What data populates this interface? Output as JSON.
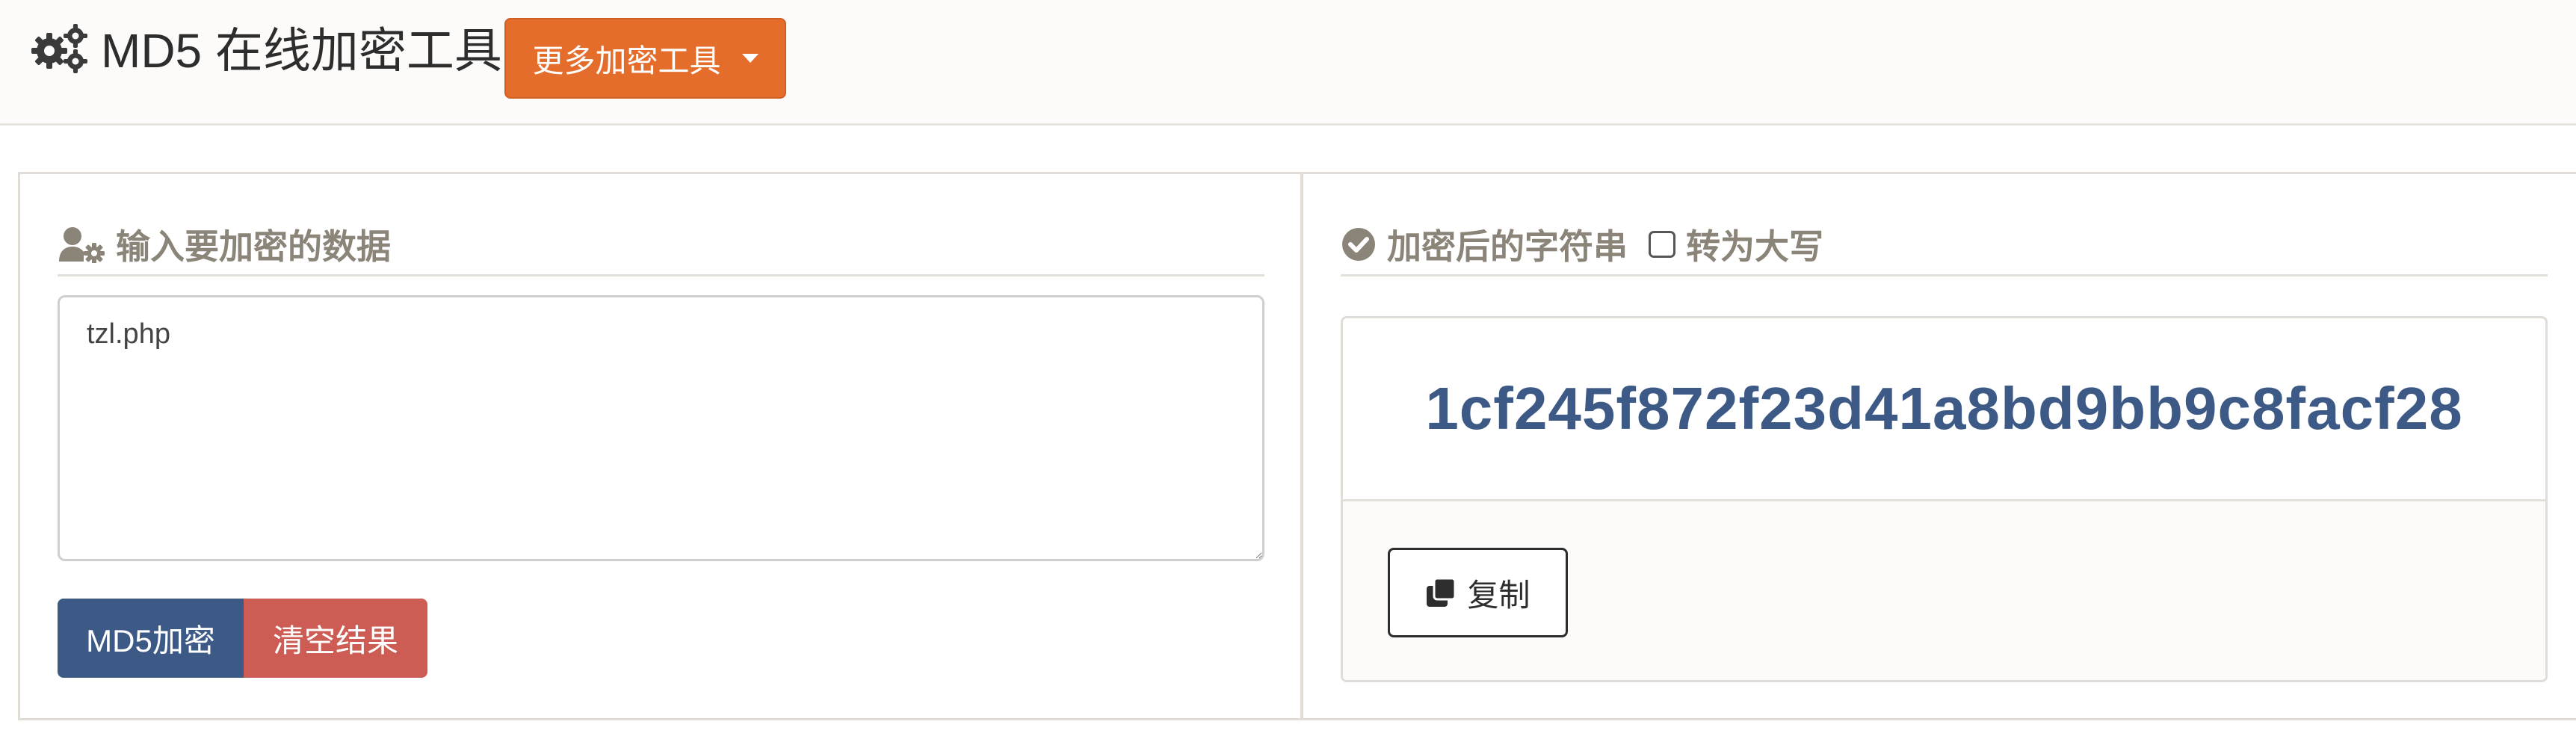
{
  "header": {
    "title": "MD5 在线加密工具",
    "logo_icon": "gears-icon",
    "more_tools_label": "更多加密工具"
  },
  "input_panel": {
    "title": "输入要加密的数据",
    "icon": "user-gear-icon",
    "input_value": "tzl.php",
    "encrypt_label": "MD5加密",
    "clear_label": "清空结果"
  },
  "result_panel": {
    "title": "加密后的字符串",
    "icon": "check-circle-icon",
    "uppercase_label": "转为大写",
    "uppercase_checked": false,
    "hash": "1cf245f872f23d41a8bd9bb9c8facf28",
    "copy_label": "复制",
    "copy_icon": "clone-icon"
  },
  "colors": {
    "primary": "#3d5a87",
    "danger": "#cc5c54",
    "orange": "#e56d2c",
    "muted": "#8b8479"
  }
}
